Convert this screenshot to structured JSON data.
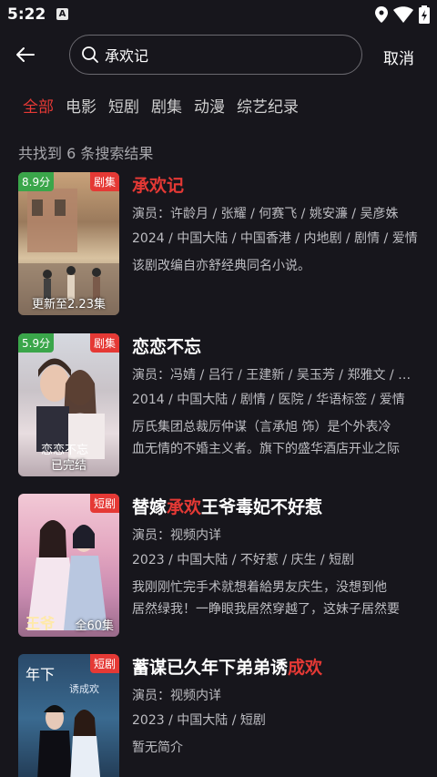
{
  "status": {
    "time": "5:22"
  },
  "search": {
    "value": "承欢记",
    "placeholder": ""
  },
  "cancel_label": "取消",
  "tabs": [
    "全部",
    "电影",
    "短剧",
    "剧集",
    "动漫",
    "综艺纪录"
  ],
  "result_count": "共找到 6 条搜索结果",
  "results": [
    {
      "rating": "8.9分",
      "type": "剧集",
      "caption": "更新至2.23集",
      "title_pre": "",
      "title_hl": "承欢记",
      "title_post": "",
      "cast": "演员：许龄月 / 张耀 / 何赛飞 / 姚安濂 / 吴彦姝",
      "meta": "2024 / 中国大陆 / 中国香港 / 内地剧 / 剧情 / 爱情",
      "desc1": "该剧改编自亦舒经典同名小说。",
      "desc2": ""
    },
    {
      "rating": "5.9分",
      "type": "剧集",
      "caption": "已完结",
      "title_pre": "恋恋不忘",
      "title_hl": "",
      "title_post": "",
      "cast": "演员：冯婧 / 吕行 / 王建新 / 吴玉芳 / 郑雅文 / 何晟铭",
      "meta": "2014 / 中国大陆 / 剧情 / 医院 / 华语标签 / 爱情",
      "desc1": "厉氏集团总裁厉仲谋（言承旭 饰）是个外表冷",
      "desc2": "血无情的不婚主义者。旗下的盛华酒店开业之际"
    },
    {
      "rating": "",
      "type": "短剧",
      "caption": "全60集",
      "title_pre": "替嫁",
      "title_hl": "承欢",
      "title_post": "王爷毒妃不好惹",
      "cast": "演员：视频内详",
      "meta": "2023 / 中国大陆 / 不好惹 / 庆生 / 短剧",
      "desc1": "我刚刚忙完手术就想着給男友庆生，没想到他",
      "desc2": "居然绿我！一睁眼我居然穿越了，这妹子居然要"
    },
    {
      "rating": "",
      "type": "短剧",
      "caption": "",
      "title_pre": "蓄谋已久年下弟弟诱",
      "title_hl": "成欢",
      "title_post": "",
      "cast": "演员：视频内详",
      "meta": "2023 / 中国大陆 / 短剧",
      "desc1": "暂无简介",
      "desc2": ""
    }
  ],
  "colors": {
    "accent": "#e53935",
    "rating": "#3aa64a",
    "background": "#17161c"
  }
}
